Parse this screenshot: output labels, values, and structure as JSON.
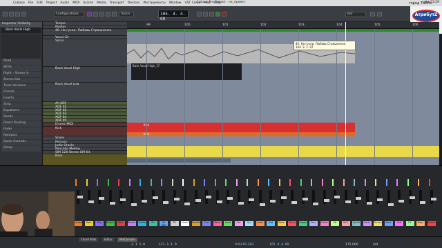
{
  "menubar": {
    "apple": "",
    "items": [
      "Cubase",
      "File",
      "Edit",
      "Project",
      "Audio",
      "MIDI",
      "Scores",
      "Media",
      "Transport",
      "Devices",
      "Инструменты",
      "Window",
      "VST Cloud",
      "Hub",
      "Help"
    ],
    "window_title": "Cubase Pro Project - не_проект",
    "clock": "Нд 23:29"
  },
  "city": "город ТВЕРЬ",
  "logo": {
    "text": "АтрибутZ",
    "subtitle": "студия звукозаписи"
  },
  "toolbar": {
    "config": "Configurations",
    "touch": "Touch",
    "grid": "Bar",
    "counter": "105. 4. 4. 68"
  },
  "inspector": {
    "tabs": [
      "Inspector",
      "Visibility"
    ],
    "track": "Back Vocal High",
    "sections": [
      "Read",
      "Write",
      "Right - Stereo In",
      "Stereo Out",
      "Track Versions",
      "Chords",
      "Inserts",
      "Strip",
      "Equalizers",
      "Sends",
      "Direct Routing",
      "Fader",
      "Notepad",
      "Quick Controls",
      "Setup"
    ]
  },
  "tracks": [
    {
      "name": "Tempo"
    },
    {
      "name": "Marker"
    },
    {
      "name": "40. На гусли. Любовь Страшненко"
    },
    {
      "name": "Vocal (2)"
    },
    {
      "name": "Vocal"
    },
    {
      "name": "Back Vocal High"
    },
    {
      "name": "Back Vocal Low"
    },
    {
      "name": "All XDF"
    },
    {
      "name": "XDF 01"
    },
    {
      "name": "XDF 02"
    },
    {
      "name": "XDF 03"
    },
    {
      "name": "XDF 04"
    },
    {
      "name": "XDF 05"
    },
    {
      "name": "Drums MIDI"
    },
    {
      "name": "Kick"
    },
    {
      "name": "Snare"
    },
    {
      "name": "Percuss"
    },
    {
      "name": "Jodie Oracle"
    },
    {
      "name": "Marcello Mellow"
    },
    {
      "name": "SIM 128 Stereo GM Kit"
    },
    {
      "name": "Bass"
    },
    {
      "name": "PS01 - Fretted.64 01"
    }
  ],
  "ruler": {
    "bars": [
      "99",
      "100",
      "101",
      "102",
      "103",
      "104",
      "105",
      "106",
      "107"
    ]
  },
  "events": {
    "vocal": "Vocal",
    "back_high": "Back Vocal High_17",
    "kick": "Kick",
    "snare": "Kick"
  },
  "tooltip": {
    "line1": "40. На гусли. Любовь Страшненко",
    "line2": "104. 3. 1. 97"
  },
  "mixer": {
    "channels": [
      "Cymbal",
      "Bass",
      "Key",
      "Bright",
      "Perc",
      "Drums",
      "Guitar",
      "Str",
      "All XDF",
      "BV",
      "Vocal",
      "BackVo",
      "Out",
      "Bass",
      "Lead",
      "Out",
      "Syn",
      "Lead",
      "Pad",
      "Bass",
      "Drum",
      "Loops",
      "Perc",
      "Guitar",
      "Str",
      "Str2",
      "Synth",
      "Pads",
      "Drums",
      "Bass",
      "Out",
      "FX",
      "Keys",
      "Master"
    ],
    "colors": [
      "#ff7a1a",
      "#f0d020",
      "#8a6cff",
      "#40c040",
      "#e04040",
      "#c080ff",
      "#30b0e0",
      "#40c0a0",
      "#60a0ff",
      "#d0d0d0",
      "#ffffff",
      "#e0a020",
      "#8080ff",
      "#ff60a0",
      "#60e060",
      "#f0a0f0",
      "#a0e0ff",
      "#ff9040",
      "#60c0ff",
      "#ffcc40",
      "#ff5060",
      "#40d080",
      "#b0b0ff",
      "#ff80c0",
      "#c0ff80",
      "#ffa0a0",
      "#80c0c0",
      "#d090ff",
      "#f0e060",
      "#70a0ff",
      "#ff70ff",
      "#90ff90",
      "#ffb060",
      "#ff4040"
    ]
  },
  "bottom": {
    "tabs": [
      "Chord Pads",
      "Editor",
      "MixConsole"
    ],
    "pos": "2. 1. 1. 0",
    "len": "111. 1. 1. 0",
    "tempo": "175.000",
    "sig": "4/4",
    "time": "0:03:01.393",
    "counter": "105. 4. 4. 68"
  }
}
